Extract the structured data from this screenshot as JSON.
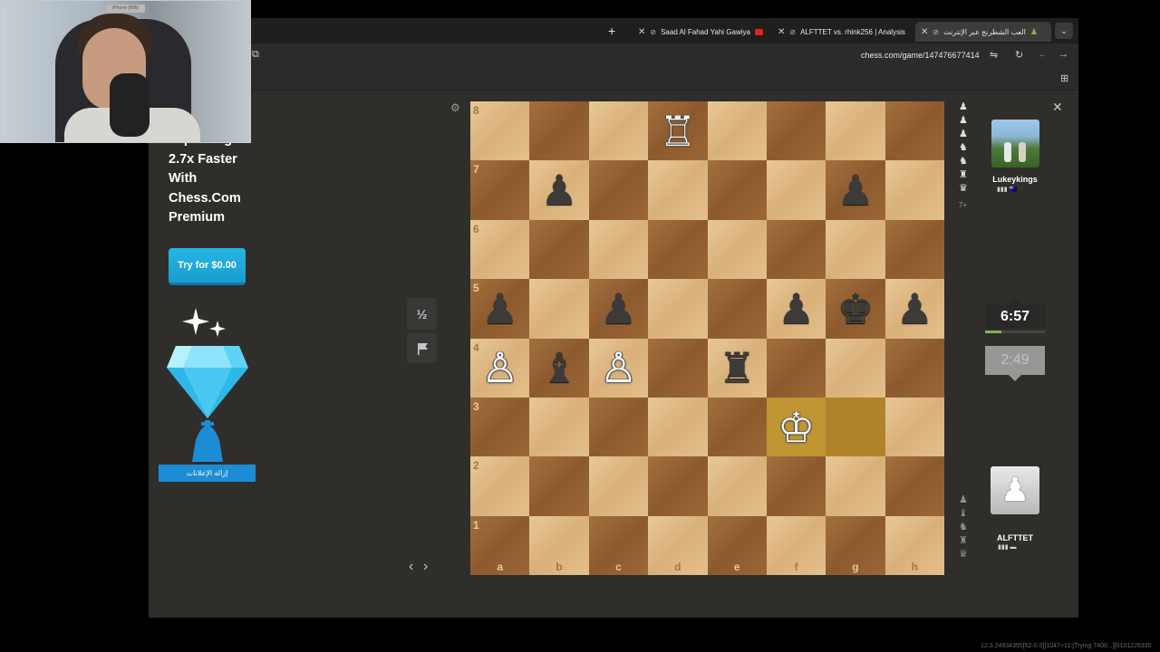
{
  "browser": {
    "tabs": [
      {
        "label": "العب الشطرنج عبر الإنترنت",
        "active": true
      },
      {
        "label": "ALFTTET vs. rhink256 | Analysis",
        "active": false
      },
      {
        "label": "Saad Al Fahad Yahi Gawiya",
        "active": false
      }
    ],
    "url": "chess.com/game/147476677414"
  },
  "ad": {
    "headline": "Improving 2.7x Faster With Chess.Com Premium",
    "cta_label": "Try for $0.00",
    "remove_ads_label": "إزالة الإعلانات"
  },
  "board": {
    "orientation": "white",
    "files": [
      "a",
      "b",
      "c",
      "d",
      "e",
      "f",
      "g",
      "h"
    ],
    "ranks": [
      "8",
      "7",
      "6",
      "5",
      "4",
      "3",
      "2",
      "1"
    ],
    "highlight_squares": [
      "f3",
      "g3"
    ],
    "pieces": [
      {
        "square": "d8",
        "piece": "rook",
        "color": "white"
      },
      {
        "square": "b7",
        "piece": "pawn",
        "color": "black"
      },
      {
        "square": "g7",
        "piece": "pawn",
        "color": "black"
      },
      {
        "square": "a5",
        "piece": "pawn",
        "color": "black"
      },
      {
        "square": "c5",
        "piece": "pawn",
        "color": "black"
      },
      {
        "square": "f5",
        "piece": "pawn",
        "color": "black"
      },
      {
        "square": "g5",
        "piece": "king",
        "color": "black"
      },
      {
        "square": "h5",
        "piece": "pawn",
        "color": "black"
      },
      {
        "square": "a4",
        "piece": "pawn",
        "color": "white"
      },
      {
        "square": "b4",
        "piece": "bishop",
        "color": "black"
      },
      {
        "square": "c4",
        "piece": "pawn",
        "color": "white"
      },
      {
        "square": "e4",
        "piece": "rook",
        "color": "black"
      },
      {
        "square": "f3",
        "piece": "king",
        "color": "white"
      }
    ]
  },
  "controls": {
    "draw_label": "½"
  },
  "opponent": {
    "name": "Lukeykings",
    "clock": "6:57",
    "material_advantage": "7+",
    "captured_icons": [
      "pawn",
      "pawn",
      "pawn",
      "knight",
      "knight",
      "rook",
      "queen"
    ]
  },
  "player": {
    "name": "ALFTTET",
    "clock": "2:49",
    "clock_progress": 0.27,
    "captured_icons": [
      "pawn",
      "bishop",
      "knight",
      "rook",
      "queen"
    ]
  },
  "icons": {
    "settings": "gear-icon",
    "resign": "flag-icon",
    "close": "close-icon"
  },
  "colors": {
    "light_square": "#e3c08a",
    "dark_square": "#9c6737",
    "highlight": "#c09533",
    "accent_green": "#81b64c",
    "cta_blue": "#1a9bd0"
  },
  "webcam": {
    "label": "iPhone (Wifi)"
  },
  "status_text": "12.3.24934355[52-0.0][1047+11:[Trying 7400...][0101226330"
}
